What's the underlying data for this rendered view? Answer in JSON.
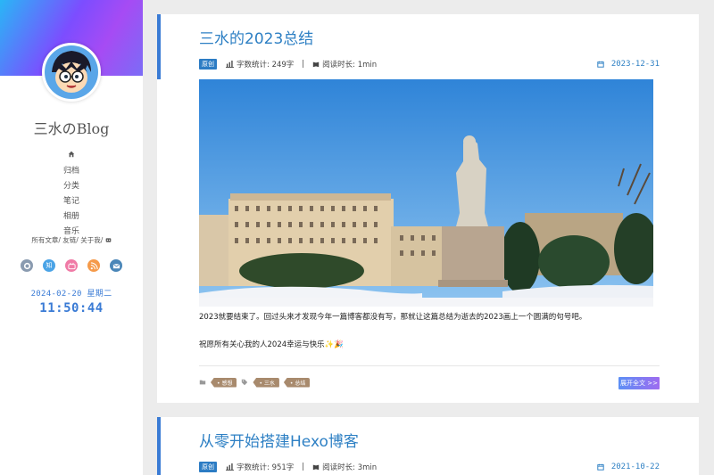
{
  "sidebar": {
    "site_title": "三水のBlog",
    "nav": [
      {
        "label": "",
        "icon": "home-icon"
      },
      {
        "label": "归档"
      },
      {
        "label": "分类"
      },
      {
        "label": "笔记"
      },
      {
        "label": "相册"
      },
      {
        "label": "音乐"
      }
    ],
    "links_text": "所有文章/ 友链/ 关于我/",
    "social": [
      {
        "icon": "github-icon",
        "glyph": "",
        "color": "#8a9bb0"
      },
      {
        "icon": "zhihu-icon",
        "glyph": "知",
        "color": "#4aa3e6"
      },
      {
        "icon": "bilibili-icon",
        "glyph": "",
        "color": "#f07aa6"
      },
      {
        "icon": "rss-icon",
        "glyph": "",
        "color": "#f59a4a"
      },
      {
        "icon": "email-icon",
        "glyph": "",
        "color": "#4a86b8"
      }
    ],
    "date": "2024-02-20  星期二",
    "time": "11:50:44"
  },
  "posts": [
    {
      "title": "三水的2023总结",
      "badge": "原创",
      "word_count": "字数统计: 249字",
      "read_time": "阅读时长: 1min",
      "date": "2023-12-31",
      "excerpt_1": "2023就要结束了。回过头来才发现今年一篇博客都没有写，那就让这篇总结为逝去的2023画上一个圆满的句号吧。",
      "excerpt_2": "祝愿所有关心我的人2024幸运与快乐✨🎉",
      "category": "• 感想",
      "tags": [
        "• 三水",
        "• 总结"
      ],
      "read_more": "展开全文 >>"
    },
    {
      "title": "从零开始搭建Hexo博客",
      "badge": "原创",
      "word_count": "字数统计: 951字",
      "read_time": "阅读时长: 3min",
      "date": "2021-10-22"
    }
  ],
  "meta_separator": "|"
}
